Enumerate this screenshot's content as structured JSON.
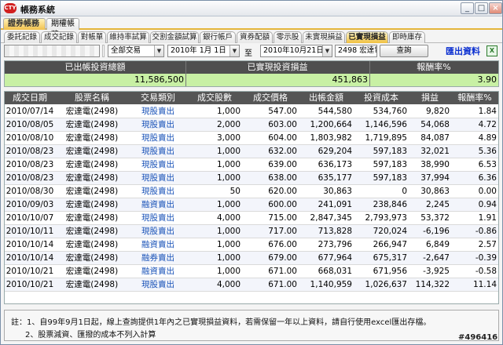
{
  "window": {
    "title": "帳務系統",
    "app_badge": "CTY",
    "buttons": {
      "minimize": "_",
      "maximize": "□",
      "close": "×"
    }
  },
  "outer_tabs": [
    {
      "label": "證券帳務",
      "active": true
    },
    {
      "label": "期權帳務",
      "active": false
    }
  ],
  "inner_tabs": [
    {
      "label": "委託記錄",
      "active": false
    },
    {
      "label": "成交記錄",
      "active": false
    },
    {
      "label": "對帳單",
      "active": false
    },
    {
      "label": "維持率試算",
      "active": false
    },
    {
      "label": "交割金額試算",
      "active": false
    },
    {
      "label": "銀行帳戶",
      "active": false
    },
    {
      "label": "資券配額",
      "active": false
    },
    {
      "label": "零示股",
      "active": false
    },
    {
      "label": "未實現損益",
      "active": false
    },
    {
      "label": "已實現損益",
      "active": true
    },
    {
      "label": "即時庫存",
      "active": false
    }
  ],
  "filters": {
    "account_value": "",
    "trade_type": "全部交易",
    "start_date": "2010年 1月 1日",
    "date_separator": "至",
    "end_date": "2010年10月21日",
    "stock": "2498 宏達電",
    "query_button": "查詢",
    "export_label": "匯出資料",
    "export_icon": "excel-icon"
  },
  "summary": {
    "headers": [
      "已出帳投資總額",
      "已實現投資損益",
      "報酬率%"
    ],
    "values": [
      "11,586,500",
      "451,863",
      "3.90"
    ]
  },
  "table": {
    "columns": [
      "成交日期",
      "股票名稱",
      "交易類別",
      "成交股數",
      "成交價格",
      "出帳金額",
      "投資成本",
      "損益",
      "報酬率%"
    ],
    "rows": [
      [
        "2010/07/14",
        "宏達電(2498)",
        "現股賣出",
        "1,000",
        "547.00",
        "544,580",
        "534,760",
        "9,820",
        "1.84"
      ],
      [
        "2010/08/05",
        "宏達電(2498)",
        "現股賣出",
        "2,000",
        "603.00",
        "1,200,664",
        "1,146,596",
        "54,068",
        "4.72"
      ],
      [
        "2010/08/10",
        "宏達電(2498)",
        "現股賣出",
        "3,000",
        "604.00",
        "1,803,982",
        "1,719,895",
        "84,087",
        "4.89"
      ],
      [
        "2010/08/23",
        "宏達電(2498)",
        "現股賣出",
        "1,000",
        "632.00",
        "629,204",
        "597,183",
        "32,021",
        "5.36"
      ],
      [
        "2010/08/23",
        "宏達電(2498)",
        "現股賣出",
        "1,000",
        "639.00",
        "636,173",
        "597,183",
        "38,990",
        "6.53"
      ],
      [
        "2010/08/23",
        "宏達電(2498)",
        "現股賣出",
        "1,000",
        "638.00",
        "635,177",
        "597,183",
        "37,994",
        "6.36"
      ],
      [
        "2010/08/30",
        "宏達電(2498)",
        "現股賣出",
        "50",
        "620.00",
        "30,863",
        "0",
        "30,863",
        "0.00"
      ],
      [
        "2010/09/03",
        "宏達電(2498)",
        "融資賣出",
        "1,000",
        "600.00",
        "241,091",
        "238,846",
        "2,245",
        "0.94"
      ],
      [
        "2010/10/07",
        "宏達電(2498)",
        "現股賣出",
        "4,000",
        "715.00",
        "2,847,345",
        "2,793,973",
        "53,372",
        "1.91"
      ],
      [
        "2010/10/11",
        "宏達電(2498)",
        "現股賣出",
        "1,000",
        "717.00",
        "713,828",
        "720,024",
        "-6,196",
        "-0.86"
      ],
      [
        "2010/10/14",
        "宏達電(2498)",
        "融資賣出",
        "1,000",
        "676.00",
        "273,796",
        "266,947",
        "6,849",
        "2.57"
      ],
      [
        "2010/10/14",
        "宏達電(2498)",
        "融券賣出",
        "1,000",
        "679.00",
        "677,964",
        "675,317",
        "-2,647",
        "-0.39"
      ],
      [
        "2010/10/21",
        "宏達電(2498)",
        "融資賣出",
        "1,000",
        "671.00",
        "668,031",
        "671,956",
        "-3,925",
        "-0.58"
      ],
      [
        "2010/10/21",
        "宏達電(2498)",
        "現股賣出",
        "4,000",
        "671.00",
        "1,140,959",
        "1,026,637",
        "114,322",
        "11.14"
      ]
    ]
  },
  "notes": [
    "註：1、自99年9月1日起，線上查詢提供1年內之已實現損益資料，若需保留一年以上資料，請自行使用excel匯出存檔。",
    "2、股票減資、匯撥的成本不列入計算"
  ],
  "watermark": "#496416",
  "colors": {
    "summary_header_bg": "#4f4f4f",
    "summary_value_bg": "#c8f0a4",
    "active_tab": "#f0c040",
    "trade_type_text": "#1a53b8",
    "export_link": "#0b2fd0"
  }
}
